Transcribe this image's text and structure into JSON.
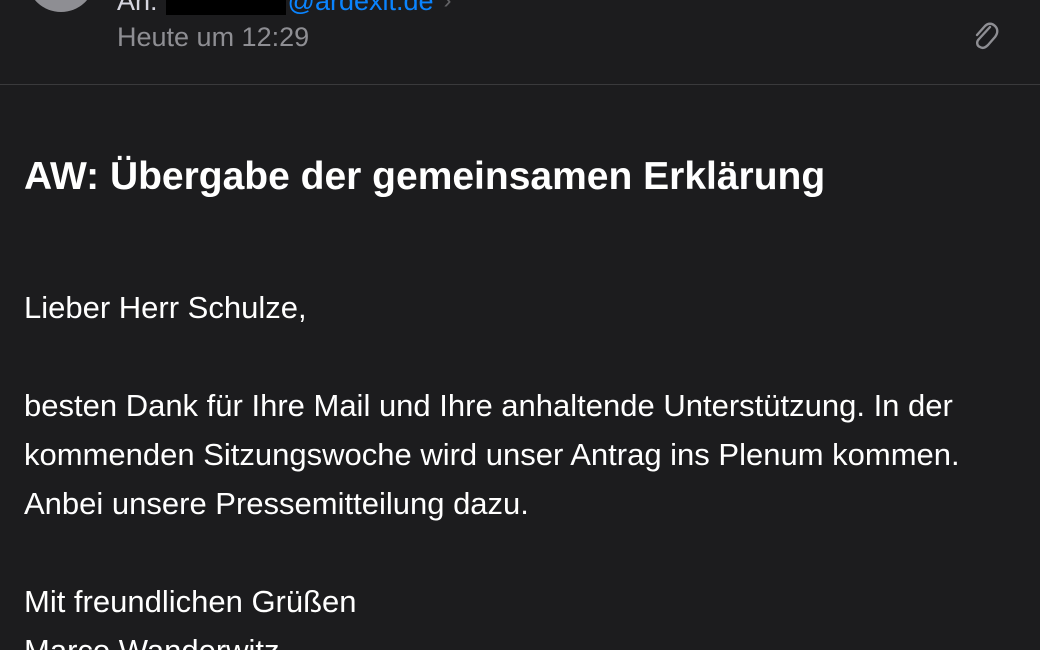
{
  "header": {
    "to_label": "An:",
    "to_domain": "@ardexit.de",
    "date": "Heute um 12:29",
    "icons": {
      "avatar": "avatar",
      "chevron": "chevron-right-icon",
      "attachment": "paperclip-icon"
    }
  },
  "email": {
    "subject": "AW: Übergabe der gemeinsamen Erklärung",
    "greeting": "Lieber Herr Schulze,",
    "paragraph": "besten Dank für Ihre Mail und Ihre anhaltende Unterstützung. In der kommenden Sitzungswoche wird unser Antrag ins Plenum kommen. Anbei unsere Pressemitteilung dazu.",
    "closing": "Mit freundlichen Grüßen",
    "signature": "Marco Wanderwitz"
  },
  "colors": {
    "background": "#1c1c1e",
    "text": "#ffffff",
    "secondary_text": "#8e8e93",
    "link": "#0a84ff",
    "divider": "#3a3a3c"
  }
}
